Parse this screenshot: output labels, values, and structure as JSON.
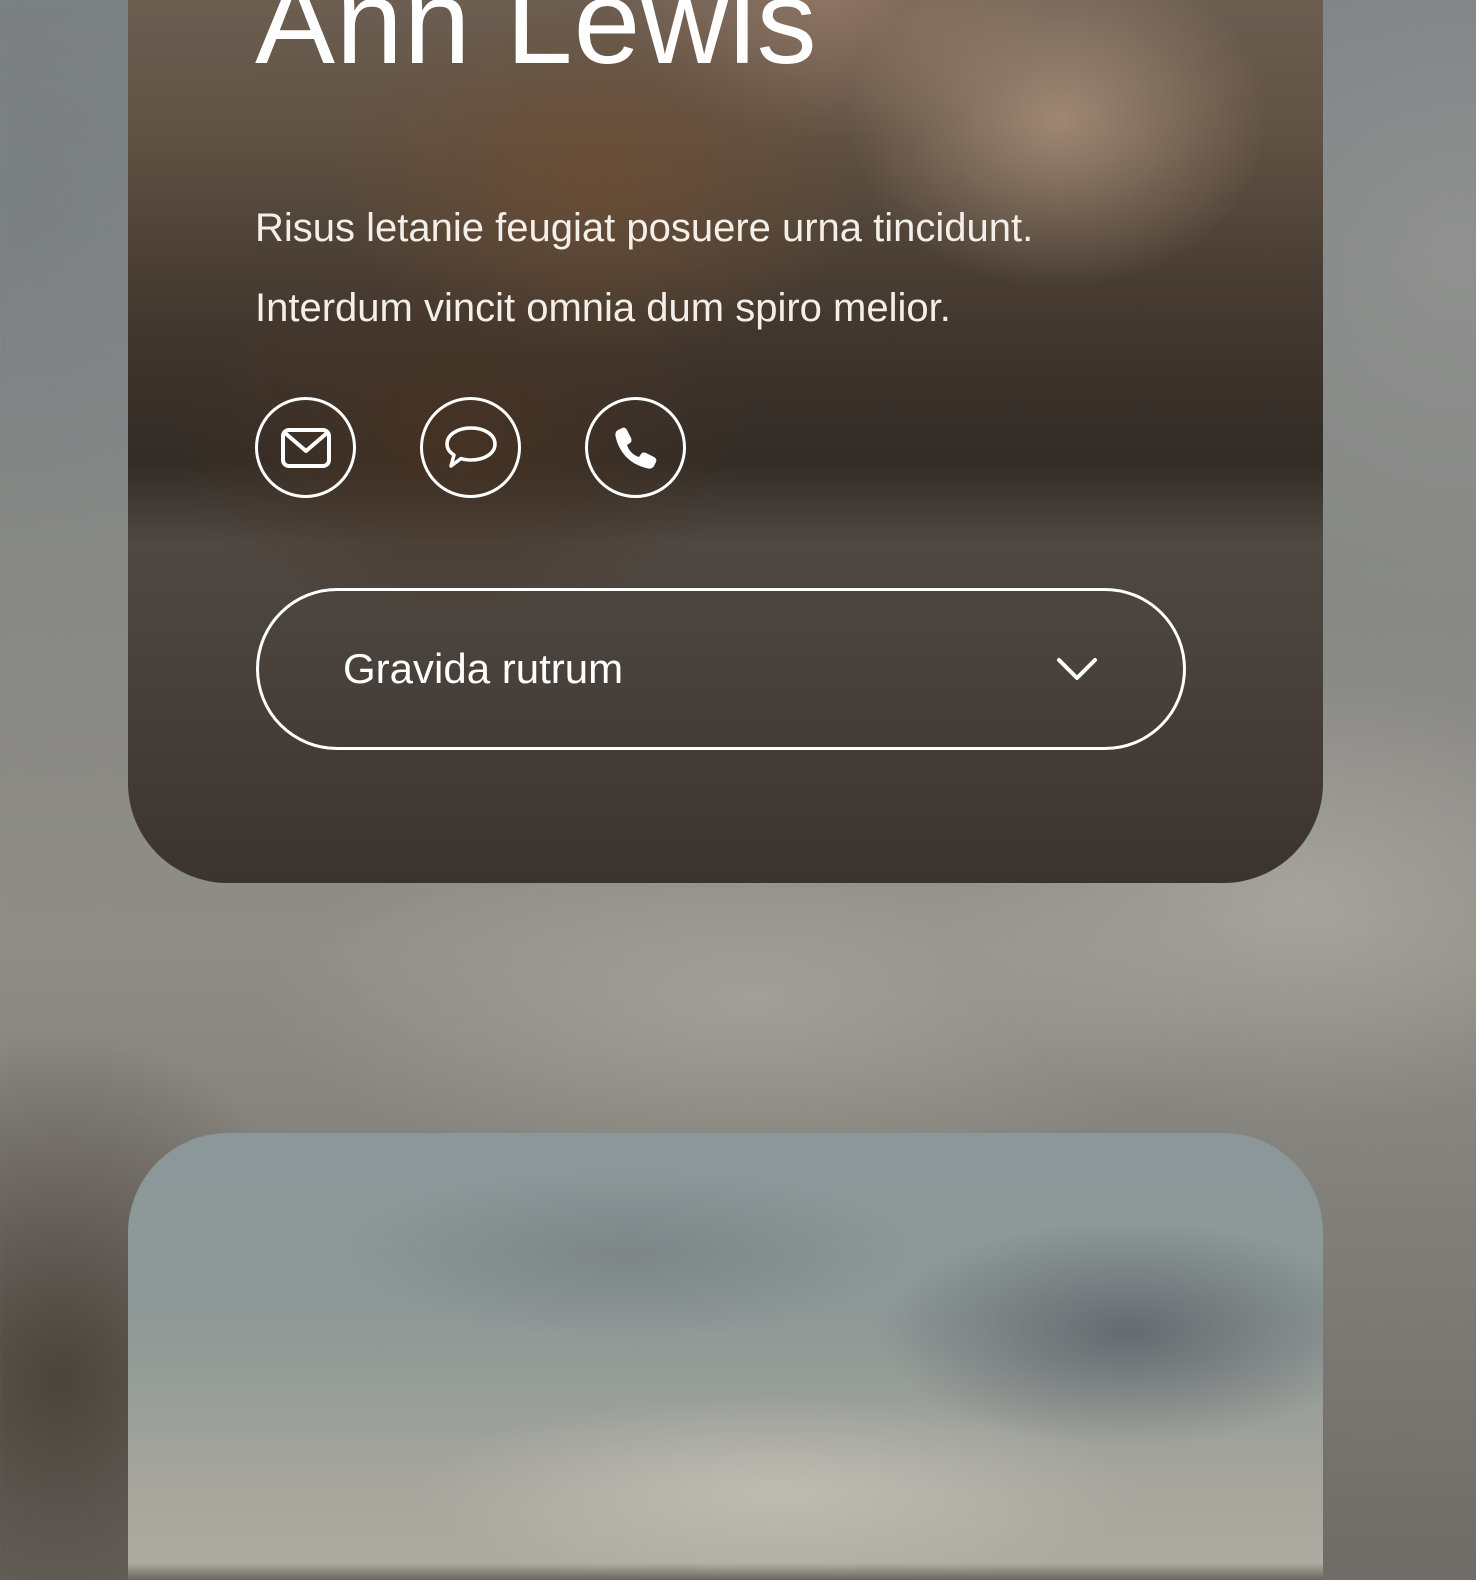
{
  "profile": {
    "name": "Ann Lewis",
    "bio_lines": [
      "Risus letanie feugiat posuere urna tincidunt.",
      "Interdum vincit omnia dum spiro melior."
    ],
    "contact_icons": [
      "mail-icon",
      "chat-bubble-icon",
      "phone-icon"
    ]
  },
  "dropdown": {
    "selected": "Gravida rutrum",
    "icon": "chevron-down-icon"
  },
  "colors": {
    "text": "#ffffff",
    "card_border": "#ffffff"
  }
}
